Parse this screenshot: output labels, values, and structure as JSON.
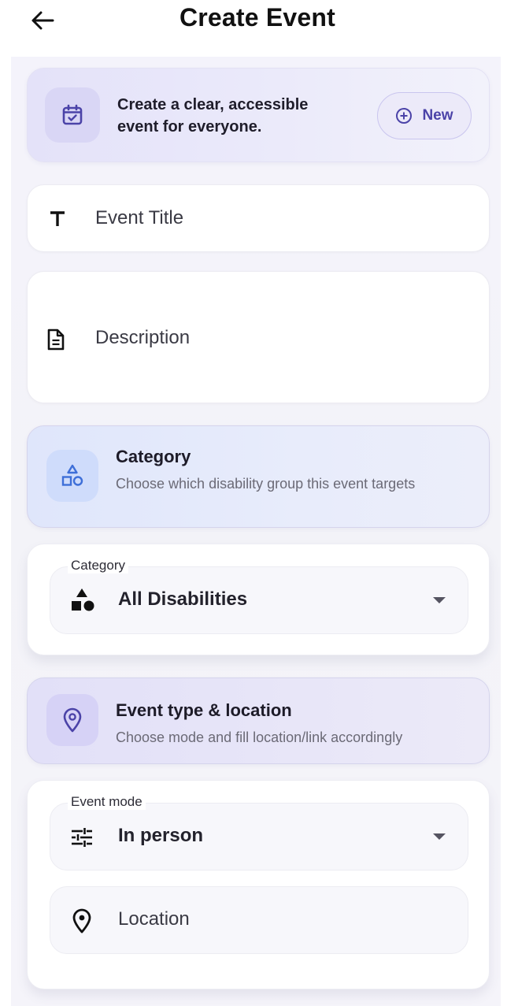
{
  "appbar": {
    "title": "Create Event",
    "back_icon": "arrow-left-icon"
  },
  "banner": {
    "icon": "calendar-check-icon",
    "text": "Create a clear, accessible event for everyone.",
    "new_button_label": "New",
    "new_button_icon": "plus-circle-icon"
  },
  "form": {
    "title_placeholder": "Event Title",
    "title_icon": "text-t-icon",
    "description_placeholder": "Description",
    "description_icon": "document-icon"
  },
  "category_section": {
    "title": "Category",
    "subtitle": "Choose which disability group this event targets",
    "icon": "shapes-icon",
    "field_label": "Category",
    "selected_value": "All Disabilities",
    "value_icon": "category-shapes-icon"
  },
  "event_section": {
    "title": "Event type & location",
    "subtitle": "Choose mode and fill location/link accordingly",
    "icon": "location-pin-icon",
    "mode_label": "Event mode",
    "mode_value": "In person",
    "mode_icon": "tune-sliders-icon",
    "location_placeholder": "Location",
    "location_icon": "location-pin-icon"
  },
  "colors": {
    "accent": "#4b43a8",
    "banner_bg": "#e4e2f9",
    "category_bg": "#dfe6fb",
    "event_bg": "#e2e0f8"
  }
}
